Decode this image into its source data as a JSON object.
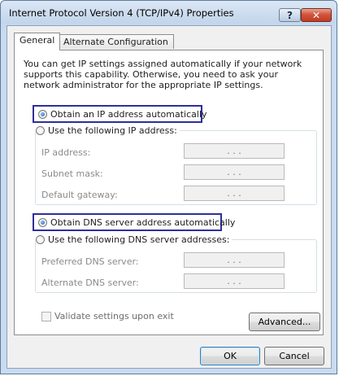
{
  "window": {
    "title": "Internet Protocol Version 4 (TCP/IPv4) Properties",
    "help_glyph": "?",
    "close_glyph": "✕"
  },
  "tabs": [
    {
      "label": "General",
      "active": true
    },
    {
      "label": "Alternate Configuration",
      "active": false
    }
  ],
  "general": {
    "intro": "You can get IP settings assigned automatically if your network supports this capability. Otherwise, you need to ask your network administrator for the appropriate IP settings.",
    "ip": {
      "auto_label": "Obtain an IP address automatically",
      "manual_label": "Use the following IP address:",
      "fields": [
        {
          "label": "IP address:",
          "value": ".   .   ."
        },
        {
          "label": "Subnet mask:",
          "value": ".   .   ."
        },
        {
          "label": "Default gateway:",
          "value": ".   .   ."
        }
      ]
    },
    "dns": {
      "auto_label": "Obtain DNS server address automatically",
      "manual_label": "Use the following DNS server addresses:",
      "fields": [
        {
          "label": "Preferred DNS server:",
          "value": ".   .   ."
        },
        {
          "label": "Alternate DNS server:",
          "value": ".   .   ."
        }
      ]
    },
    "validate_label": "Validate settings upon exit",
    "advanced_label": "Advanced..."
  },
  "footer": {
    "ok_label": "OK",
    "cancel_label": "Cancel"
  },
  "colors": {
    "highlight_border": "#2e2e9e",
    "close_button": "#c23b20"
  }
}
